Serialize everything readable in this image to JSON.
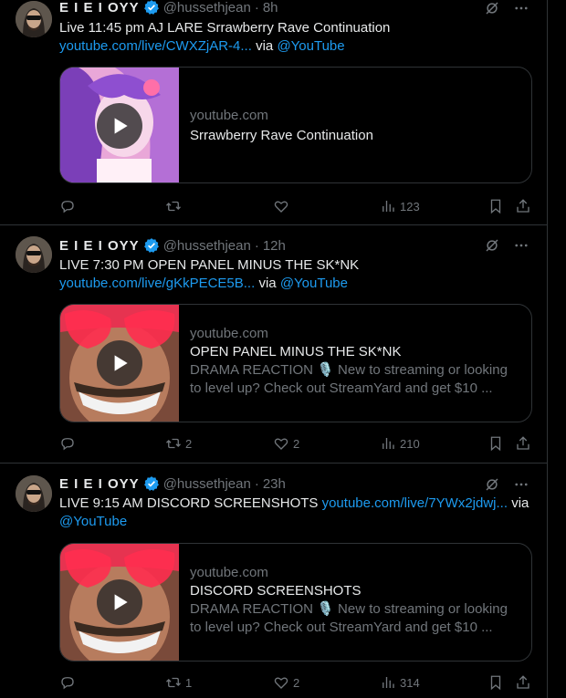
{
  "tweets": [
    {
      "author_name": "E I E I OYY",
      "handle": "@hussethjean",
      "dot": "·",
      "time": "8h",
      "text_plain": "Live 11:45 pm AJ LARE Srrawberry Rave Continuation",
      "link": "youtube.com/live/CWXZjAR-4...",
      "via": "via",
      "via_link": "@YouTube",
      "card": {
        "domain": "youtube.com",
        "title": "Srrawberry Rave Continuation",
        "desc_line1": "",
        "desc_line2": ""
      },
      "replies": "",
      "retweets": "",
      "likes": "",
      "views": "123"
    },
    {
      "author_name": "E I E I OYY",
      "handle": "@hussethjean",
      "dot": "·",
      "time": "12h",
      "text_plain": "LIVE 7:30 PM OPEN PANEL MINUS THE SK*NK",
      "link": "youtube.com/live/gKkPECE5B...",
      "via": "via",
      "via_link": "@YouTube",
      "card": {
        "domain": "youtube.com",
        "title": "OPEN PANEL MINUS THE SK*NK",
        "desc_line1": "DRAMA REACTION 🎙️ New to streaming or looking",
        "desc_line2": "to level up? Check out StreamYard and get $10 ..."
      },
      "replies": "",
      "retweets": "2",
      "likes": "2",
      "views": "210"
    },
    {
      "author_name": "E I E I OYY",
      "handle": "@hussethjean",
      "dot": "·",
      "time": "23h",
      "text_plain": "LIVE 9:15 AM DISCORD SCREENSHOTS",
      "link": "youtube.com/live/7YWx2jdwj...",
      "via": "via",
      "via_link": "@YouTube",
      "card": {
        "domain": "youtube.com",
        "title": "DISCORD SCREENSHOTS",
        "desc_line1": "DRAMA REACTION 🎙️ New to streaming or looking",
        "desc_line2": "to level up? Check out StreamYard and get $10 ..."
      },
      "replies": "",
      "retweets": "1",
      "likes": "2",
      "views": "314"
    }
  ],
  "colors": {
    "background": "#000000",
    "text": "#e7e9ea",
    "muted": "#71767b",
    "link": "#1d9bf0",
    "border": "#2f3336",
    "verified": "#1d9bf0"
  },
  "icons": [
    "grok-icon",
    "more-icon",
    "reply-icon",
    "retweet-icon",
    "like-icon",
    "views-icon",
    "bookmark-icon",
    "share-icon",
    "verified-badge-icon",
    "play-icon"
  ]
}
